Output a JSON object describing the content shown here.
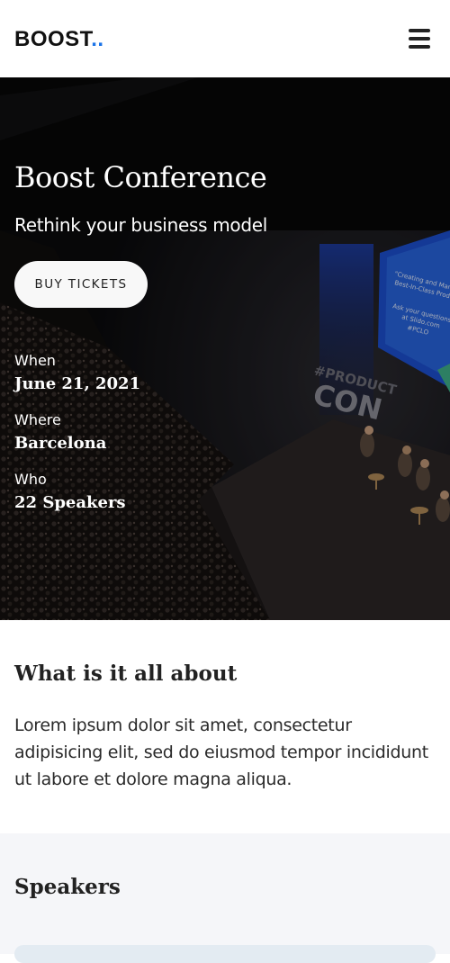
{
  "header": {
    "logo_text": "BOOST",
    "logo_dots": "..",
    "menu_icon": "hamburger-menu-icon"
  },
  "hero": {
    "title": "Boost Conference",
    "subtitle": "Rethink your business model",
    "buy_label": "BUY TICKETS",
    "details": [
      {
        "label": "When",
        "value": "June 21, 2021"
      },
      {
        "label": "Where",
        "value": "Barcelona"
      },
      {
        "label": "Who",
        "value": "22 Speakers"
      }
    ],
    "image": {
      "stage_sign": "#PRODUCT",
      "stage_sign_big": "CON",
      "screen_lines": [
        "\"Creating and Managing",
        "Best-In-Class Products\"",
        "",
        "Ask your questions",
        "at Slido.com",
        "#PCLO"
      ]
    }
  },
  "about": {
    "title": "What is it all about",
    "text": "Lorem ipsum dolor sit amet, consectetur adipisicing elit, sed do eiusmod tempor incididunt ut labore et dolore magna aliqua."
  },
  "speakers": {
    "title": "Speakers"
  },
  "colors": {
    "accent": "#1a73e8",
    "button_bg": "#f8f8f8",
    "speakers_bg": "#f5f6f9"
  }
}
